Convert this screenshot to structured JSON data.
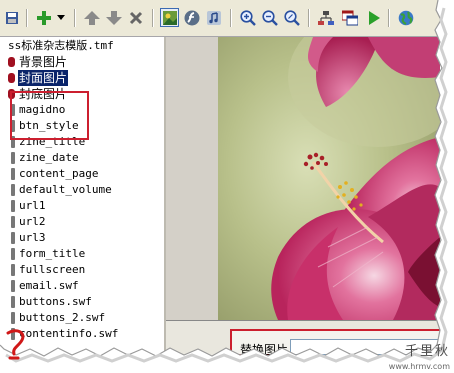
{
  "tree": {
    "root_label": "ss标准杂志模版.tmf",
    "items": [
      {
        "label": "背景图片",
        "kind": "image",
        "selected": false
      },
      {
        "label": "封面图片",
        "kind": "image",
        "selected": true
      },
      {
        "label": "封底图片",
        "kind": "image",
        "selected": false
      },
      {
        "label": "magidno",
        "kind": "item",
        "selected": false
      },
      {
        "label": "btn_style",
        "kind": "item",
        "selected": false
      },
      {
        "label": "zine_title",
        "kind": "item",
        "selected": false
      },
      {
        "label": "zine_date",
        "kind": "item",
        "selected": false
      },
      {
        "label": "content_page",
        "kind": "item",
        "selected": false
      },
      {
        "label": "default_volume",
        "kind": "item",
        "selected": false
      },
      {
        "label": "url1",
        "kind": "item",
        "selected": false
      },
      {
        "label": "url2",
        "kind": "item",
        "selected": false
      },
      {
        "label": "url3",
        "kind": "item",
        "selected": false
      },
      {
        "label": "form_title",
        "kind": "item",
        "selected": false
      },
      {
        "label": "fullscreen",
        "kind": "item",
        "selected": false
      },
      {
        "label": "email.swf",
        "kind": "item",
        "selected": false
      },
      {
        "label": "buttons.swf",
        "kind": "item",
        "selected": false
      },
      {
        "label": "buttons_2.swf",
        "kind": "item",
        "selected": false
      },
      {
        "label": "contentinfo.swf",
        "kind": "item",
        "selected": false
      }
    ]
  },
  "properties": {
    "field_label": "替换图片",
    "field_value": ""
  },
  "toolbar": {
    "buttons": [
      "save-icon",
      "add-icon",
      "up-arrow-icon",
      "down-arrow-icon",
      "delete-icon",
      "image-icon",
      "flash-icon",
      "music-icon",
      "zoom-in-icon",
      "zoom-out-icon",
      "zoom-reset-icon",
      "tree-icon",
      "window-icon",
      "play-icon",
      "globe-icon"
    ]
  },
  "watermark": {
    "text": "千里秋",
    "url": "www.hrmv.com"
  },
  "colors": {
    "selection": "#0a246a",
    "highlight_box": "#cc1f2f",
    "toolbar_bg": "#ece9d8",
    "flower_pink": "#c8306a"
  }
}
